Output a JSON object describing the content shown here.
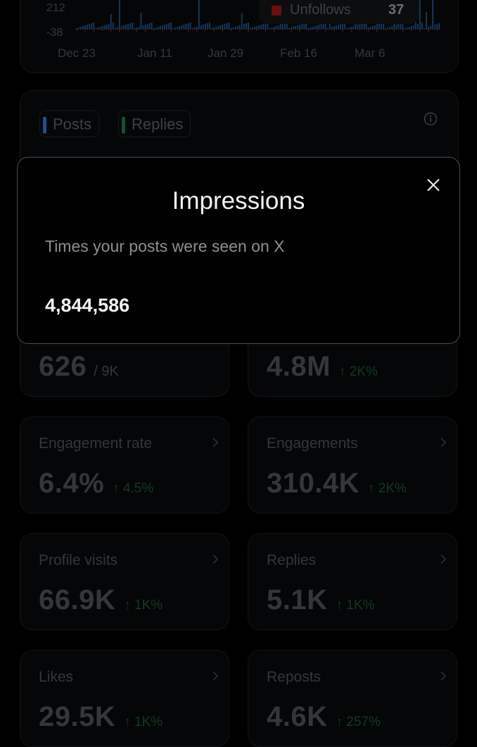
{
  "chart": {
    "y_ticks": [
      "212",
      "-38"
    ],
    "x_ticks": [
      "Dec 23",
      "Jan 11",
      "Jan 29",
      "Feb 16",
      "Mar 6"
    ],
    "legend": {
      "label": "Unfollows",
      "value": "37",
      "color": "#6b1010"
    }
  },
  "tabs": [
    {
      "label": "Posts",
      "color": "#1d4e89"
    },
    {
      "label": "Replies",
      "color": "#11532e"
    }
  ],
  "modal": {
    "title": "Impressions",
    "description": "Times your posts were seen on X",
    "value": "4,844,586"
  },
  "cards": [
    {
      "label": "",
      "value": "626",
      "sub": "/ 9K",
      "delta": ""
    },
    {
      "label": "",
      "value": "4.8M",
      "sub": "",
      "delta": "↑ 2K%"
    },
    {
      "label": "Engagement rate",
      "value": "6.4%",
      "sub": "",
      "delta": "↑ 4.5%"
    },
    {
      "label": "Engagements",
      "value": "310.4K",
      "sub": "",
      "delta": "↑ 2K%"
    },
    {
      "label": "Profile visits",
      "value": "66.9K",
      "sub": "",
      "delta": "↑ 1K%"
    },
    {
      "label": "Replies",
      "value": "5.1K",
      "sub": "",
      "delta": "↑ 1K%"
    },
    {
      "label": "Likes",
      "value": "29.5K",
      "sub": "",
      "delta": "↑ 1K%"
    },
    {
      "label": "Reposts",
      "value": "4.6K",
      "sub": "",
      "delta": "↑ 257%"
    }
  ]
}
